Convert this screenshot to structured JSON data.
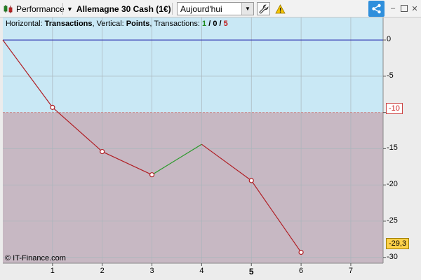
{
  "toolbar": {
    "performance_label": "Performance",
    "instrument_label": "Allemagne 30 Cash (1€)",
    "period_value": "Aujourd'hui",
    "icons": [
      "candlestick-icon",
      "chevron-down-icon",
      "wrench-icon",
      "warning-icon",
      "share-icon",
      "minimize-icon",
      "maximize-icon",
      "close-icon"
    ]
  },
  "header": {
    "prefix": "Horizontal: ",
    "horizontal_value": "Transactions",
    "mid": ", Vertical: ",
    "vertical_value": "Points",
    "suffix": ", Transactions: ",
    "wins": "1",
    "slash1": " / ",
    "draws": "0",
    "slash2": " / ",
    "losses": "5"
  },
  "copyright": "© IT-Finance.com",
  "colors": {
    "profit_zone": "#c9e8f5",
    "loss_zone": "#c7b8c3",
    "loss_line": "#b01e24",
    "win_line": "#2e9a2e",
    "zero_line": "#1a1aa8",
    "wins_text": "#1e8a1e",
    "losses_text": "#c01818"
  },
  "chart_data": {
    "type": "line",
    "x": [
      0,
      1,
      2,
      3,
      4,
      5,
      6
    ],
    "y": [
      0,
      -9.3,
      -15.4,
      -18.6,
      -14.4,
      -19.4,
      -29.3
    ],
    "segment_result": [
      "loss",
      "loss",
      "loss",
      "win",
      "loss",
      "loss"
    ],
    "xlim": [
      0,
      7.65
    ],
    "ylim": [
      -30.8,
      3.1
    ],
    "x_ticks": [
      "1",
      "2",
      "3",
      "4",
      "5",
      "6",
      "7"
    ],
    "highlighted_x_tick": "5",
    "y_ticks": [
      "0",
      "-5",
      "-10",
      "-15",
      "-20",
      "-25",
      "-30"
    ],
    "threshold_y": -10,
    "threshold_label": "-10",
    "last_value_label": "-29,3",
    "grid": true
  }
}
